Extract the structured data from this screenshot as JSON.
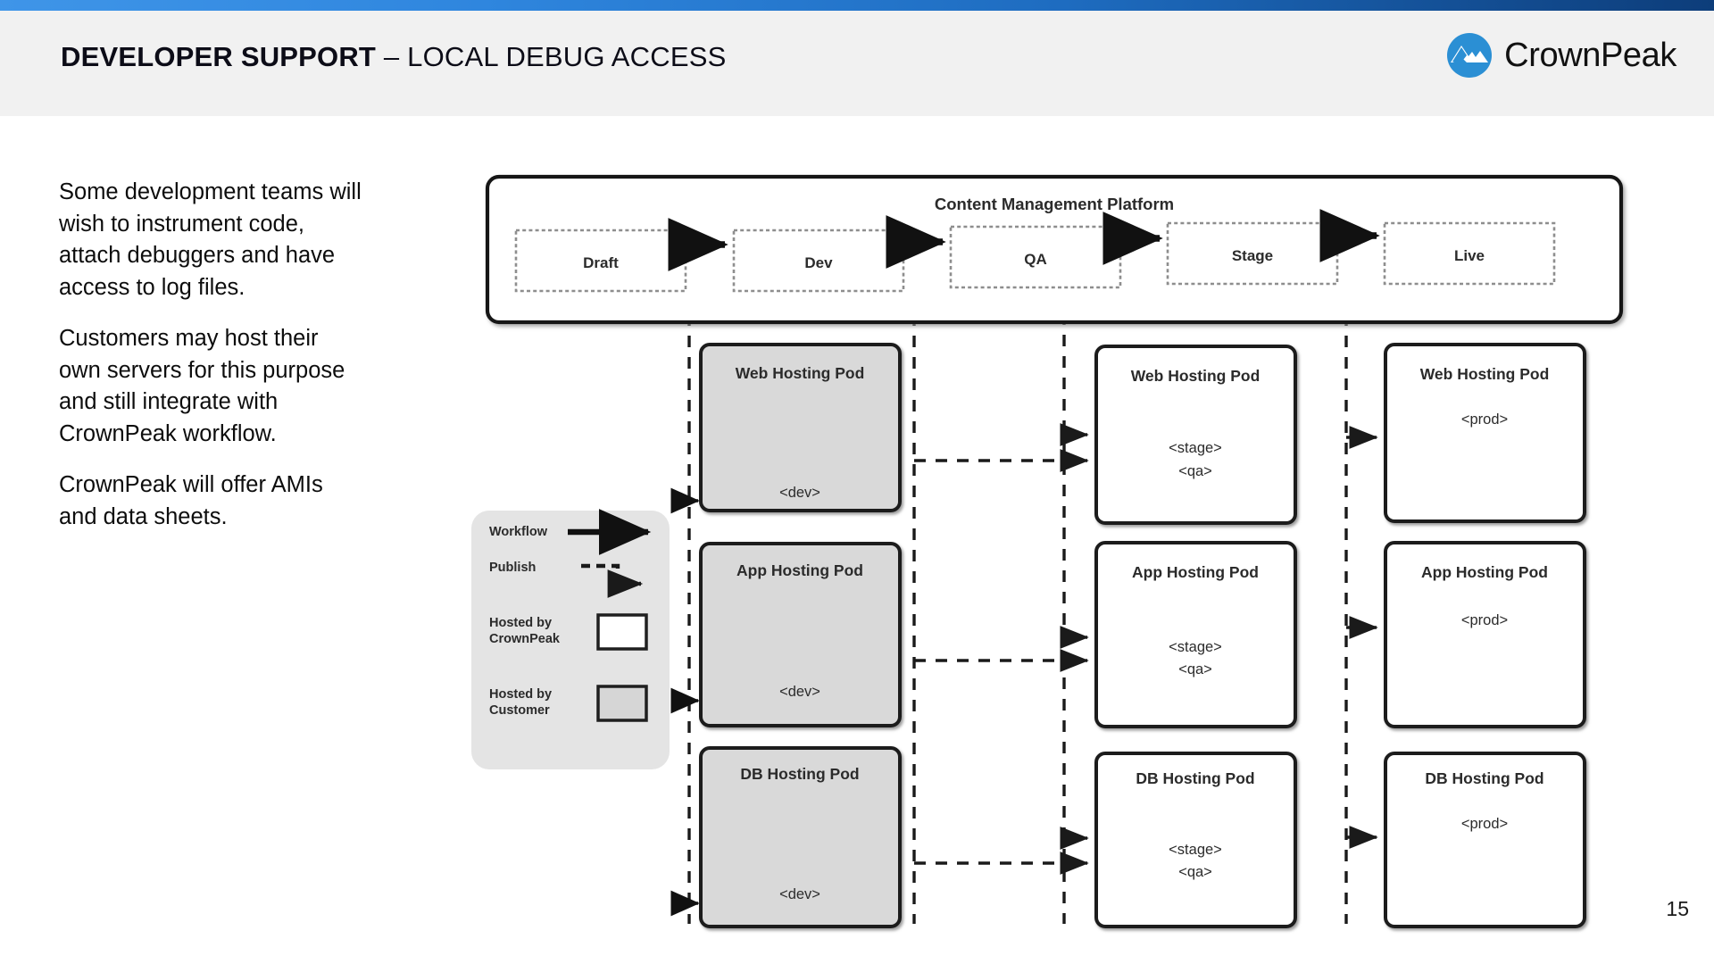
{
  "header": {
    "title_bold": "DEVELOPER SUPPORT",
    "title_light": " – LOCAL DEBUG ACCESS",
    "brand": "CrownPeak",
    "brand_icon": "crownpeak-mountain-icon",
    "accent_color_start": "#3f95e8",
    "accent_color_end": "#0d3d7a",
    "band_color": "#f1f1f1"
  },
  "body_copy": {
    "paragraphs": [
      "Some development teams will wish to instrument code, attach debuggers and have access to log files.",
      "Customers may host their own servers for this purpose and still integrate with CrownPeak workflow.",
      "CrownPeak will offer AMIs and data sheets."
    ]
  },
  "diagram": {
    "platform": {
      "label": "Content Management Platform",
      "stages": [
        {
          "label": "Draft"
        },
        {
          "label": "Dev"
        },
        {
          "label": "QA"
        },
        {
          "label": "Stage"
        },
        {
          "label": "Live"
        }
      ]
    },
    "legend": {
      "items": [
        {
          "label": "Workflow",
          "icon": "solid-arrow-icon"
        },
        {
          "label": "Publish",
          "icon": "dashed-stepped-arrow-icon"
        },
        {
          "label_line1": "Hosted by",
          "label_line2": "CrownPeak",
          "swatch": "#ffffff"
        },
        {
          "label_line1": "Hosted by",
          "label_line2": "Customer",
          "swatch": "#d6d6d6"
        }
      ]
    },
    "columns": [
      {
        "name": "dev-column",
        "hosting": "customer",
        "fill": "#d9d9d9",
        "pods": [
          {
            "title": "Web Hosting Pod",
            "envs": [
              "<dev>"
            ]
          },
          {
            "title": "App Hosting Pod",
            "envs": [
              "<dev>"
            ]
          },
          {
            "title": "DB Hosting Pod",
            "envs": [
              "<dev>"
            ]
          }
        ]
      },
      {
        "name": "stage-qa-column",
        "hosting": "crownpeak",
        "fill": "#ffffff",
        "pods": [
          {
            "title": "Web Hosting Pod",
            "envs": [
              "<stage>",
              "<qa>"
            ]
          },
          {
            "title": "App Hosting Pod",
            "envs": [
              "<stage>",
              "<qa>"
            ]
          },
          {
            "title": "DB Hosting Pod",
            "envs": [
              "<stage>",
              "<qa>"
            ]
          }
        ]
      },
      {
        "name": "prod-column",
        "hosting": "crownpeak",
        "fill": "#ffffff",
        "pods": [
          {
            "title": "Web Hosting Pod",
            "envs": [
              "<prod>"
            ]
          },
          {
            "title": "App Hosting Pod",
            "envs": [
              "<prod>"
            ]
          },
          {
            "title": "DB Hosting Pod",
            "envs": [
              "<prod>"
            ]
          }
        ]
      }
    ]
  },
  "footer": {
    "page_number": "15"
  }
}
